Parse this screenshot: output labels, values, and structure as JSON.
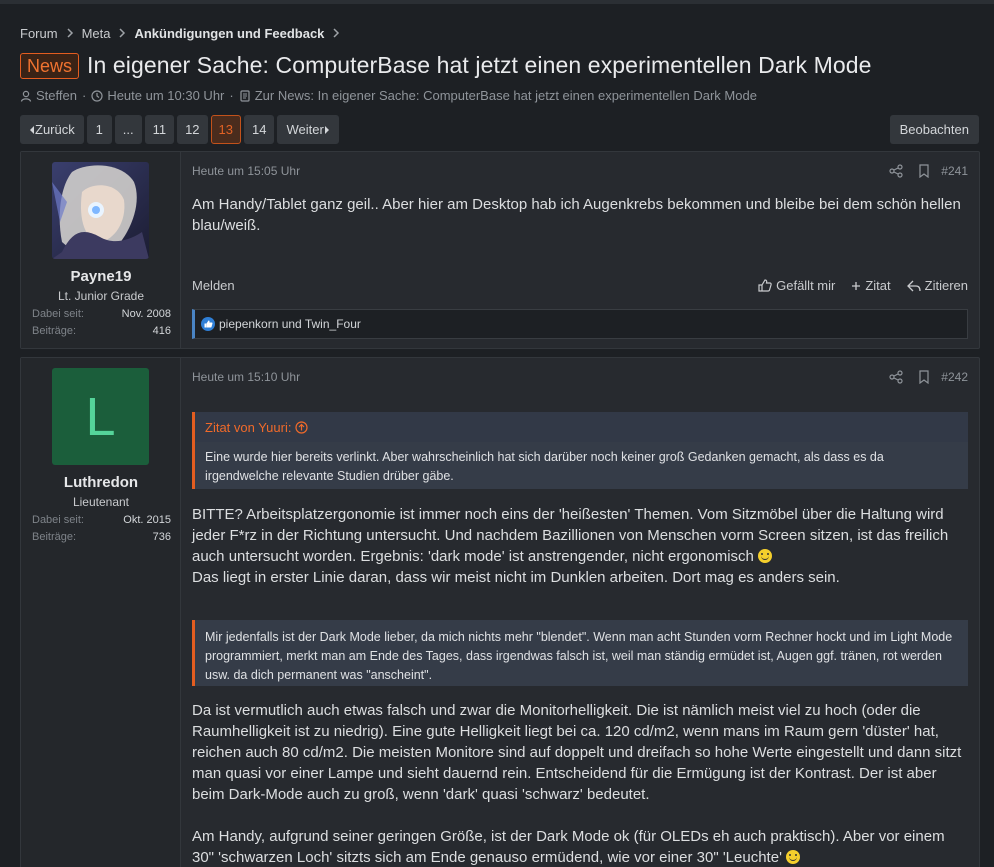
{
  "breadcrumb": [
    "Forum",
    "Meta",
    "Ankündigungen und Feedback"
  ],
  "thread": {
    "prefix": "News",
    "title": "In eigener Sache: ComputerBase hat jetzt einen experimentellen Dark Mode",
    "author": "Steffen",
    "date": "Heute um 10:30 Uhr",
    "news_link": "Zur News: In eigener Sache: ComputerBase hat jetzt einen experimentellen Dark Mode",
    "separator": "·"
  },
  "pagination": {
    "prev": "Zurück",
    "pages": [
      "1",
      "...",
      "11",
      "12",
      "13",
      "14"
    ],
    "current": "13",
    "next": "Weiter",
    "watch": "Beobachten"
  },
  "posts": [
    {
      "user": {
        "name": "Payne19",
        "title": "Lt. Junior Grade",
        "joined_label": "Dabei seit:",
        "joined": "Nov. 2008",
        "posts_label": "Beiträge:",
        "posts": "416"
      },
      "time": "Heute um 15:05 Uhr",
      "number": "#241",
      "text": "Am Handy/Tablet ganz geil.. Aber hier am Desktop hab ich Augenkrebs bekommen und bleibe bei dem schön hellen blau/weiß.",
      "report": "Melden",
      "like": "Gefällt mir",
      "quote_add": "Zitat",
      "reply": "Zitieren",
      "reactions": "piepenkorn und Twin_Four"
    },
    {
      "user": {
        "initial": "L",
        "name": "Luthredon",
        "title": "Lieutenant",
        "joined_label": "Dabei seit:",
        "joined": "Okt. 2015",
        "posts_label": "Beiträge:",
        "posts": "736",
        "avatar_color": "#1b5e3b",
        "initial_color": "#55d49a"
      },
      "time": "Heute um 15:10 Uhr",
      "number": "#242",
      "quote1_head": "Zitat von Yuuri:",
      "quote1": "Eine wurde hier bereits verlinkt. Aber wahrscheinlich hat sich darüber noch keiner groß Gedanken gemacht, als dass es da irgendwelche relevante Studien drüber gäbe.",
      "para1": "BITTE? Arbeitsplatzergonomie ist immer noch eins der 'heißesten' Themen. Vom Sitzmöbel über die Haltung wird jeder F*rz in der Richtung untersucht. Und nachdem Bazillionen von Menschen vorm Screen sitzen, ist das freilich auch untersucht worden. Ergebnis: 'dark mode' ist anstrengender, nicht ergonomisch",
      "para2": "Das liegt in erster Linie daran, dass wir meist nicht im Dunklen arbeiten. Dort mag es anders sein.",
      "quote2": "Mir jedenfalls ist der Dark Mode lieber, da mich nichts mehr \"blendet\". Wenn man acht Stunden vorm Rechner hockt und im Light Mode programmiert, merkt man am Ende des Tages, dass irgendwas falsch ist, weil man ständig ermüdet ist, Augen ggf. tränen, rot werden usw. da dich permanent was \"anscheint\".",
      "para3": "Da ist vermutlich auch etwas falsch und zwar die Monitorhelligkeit. Die ist nämlich meist viel zu hoch (oder die Raumhelligkeit ist zu niedrig). Eine gute Helligkeit liegt bei ca. 120 cd/m2, wenn mans im Raum gern 'düster' hat, reichen auch 80 cd/m2. Die meisten Monitore sind auf doppelt und dreifach so hohe Werte eingestellt und dann sitzt man quasi vor einer Lampe und sieht dauernd rein. Entscheidend für die Ermügung ist der Kontrast. Der ist aber beim Dark-Mode auch zu groß, wenn 'dark' quasi 'schwarz' bedeutet.",
      "para4": "Am Handy, aufgrund seiner geringen Größe, ist der Dark Mode ok (für OLEDs eh auch praktisch). Aber vor einem 30\" 'schwarzen Loch' sitzts sich am Ende genauso ermüdend, wie vor einer 30\" 'Leuchte'"
    }
  ],
  "colors": {
    "accent": "#e35d20",
    "background": "#1d2024",
    "panel": "#272a2f"
  }
}
